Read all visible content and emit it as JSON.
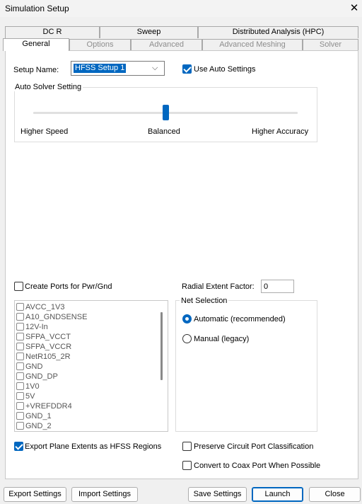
{
  "window": {
    "title": "Simulation Setup"
  },
  "tabs_row1": [
    {
      "label": "DC R",
      "enabled": true
    },
    {
      "label": "Sweep",
      "enabled": true
    },
    {
      "label": "Distributed Analysis (HPC)",
      "enabled": true
    }
  ],
  "tabs_row2": [
    {
      "label": "General",
      "active": true
    },
    {
      "label": "Options",
      "enabled": false
    },
    {
      "label": "Advanced",
      "enabled": false
    },
    {
      "label": "Advanced Meshing",
      "enabled": false
    },
    {
      "label": "Solver",
      "enabled": false
    }
  ],
  "general": {
    "setup_name_label": "Setup Name:",
    "setup_name_value": "HFSS Setup 1",
    "use_auto_settings_label": "Use Auto Settings",
    "use_auto_settings_checked": true,
    "auto_solver": {
      "title": "Auto Solver Setting",
      "labels": [
        "Higher Speed",
        "Balanced",
        "Higher Accuracy"
      ],
      "slider_value": 0.5
    },
    "create_ports_label": "Create Ports for Pwr/Gnd",
    "create_ports_checked": false,
    "radial_extent_label": "Radial Extent Factor:",
    "radial_extent_value": "0",
    "nets": [
      "AVCC_1V3",
      "A10_GNDSENSE",
      "12V-In",
      "SFPA_VCCT",
      "SFPA_VCCR",
      "NetR105_2R",
      "GND",
      "GND_DP",
      "1V0",
      "5V",
      "+VREFDDR4",
      "GND_1",
      "GND_2"
    ],
    "net_selection": {
      "title": "Net Selection",
      "options": [
        "Automatic (recommended)",
        "Manual (legacy)"
      ],
      "selected": "Automatic (recommended)"
    },
    "export_plane_label": "Export Plane Extents as HFSS Regions",
    "export_plane_checked": true,
    "preserve_port_label": "Preserve Circuit Port Classification",
    "preserve_port_checked": false,
    "coax_label": "Convert to Coax Port When Possible",
    "coax_checked": false
  },
  "footer": {
    "export_settings": "Export Settings",
    "import_settings": "Import Settings",
    "save_settings": "Save Settings",
    "launch": "Launch",
    "close": "Close"
  },
  "colors": {
    "accent": "#0067c0",
    "disabled_text": "#8d8d8d",
    "window_bg": "#f0f0f0"
  }
}
